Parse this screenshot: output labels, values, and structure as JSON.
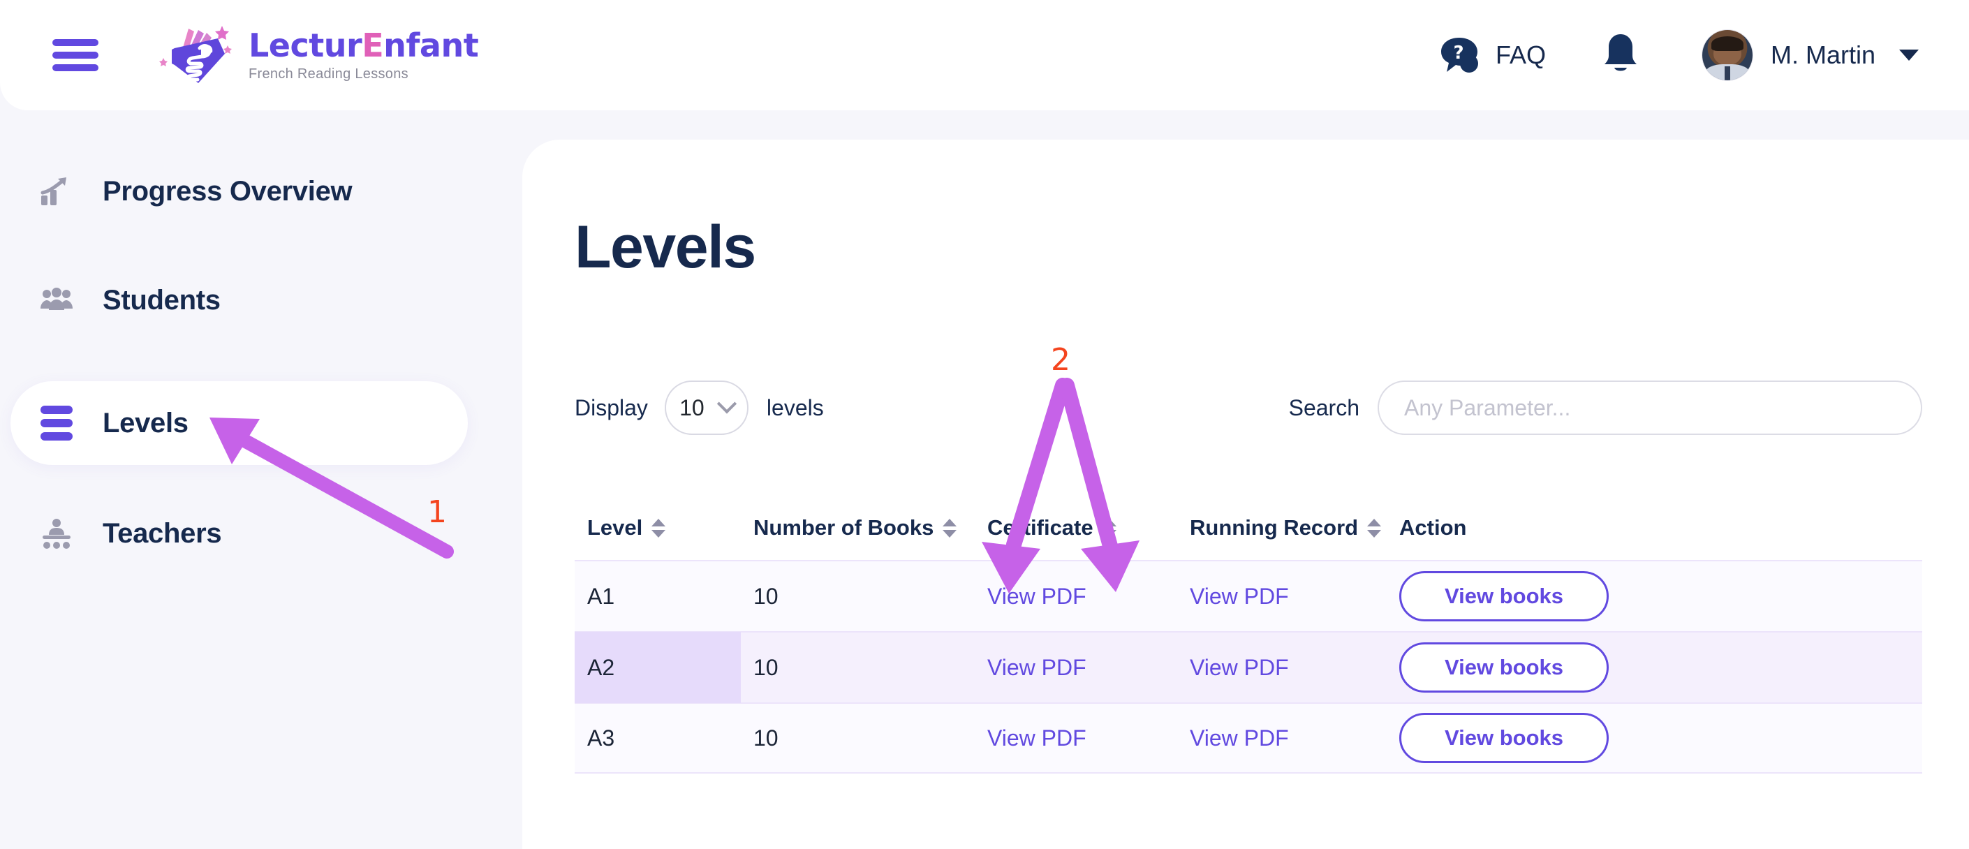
{
  "header": {
    "menu_icon": "hamburger-icon",
    "logo": {
      "title_part1": "Lectur",
      "title_accent": "E",
      "title_part2": "nfant",
      "tagline": "French Reading Lessons"
    },
    "faq_label": "FAQ",
    "faq_icon": "question-chat-icon",
    "notification_icon": "bell-icon",
    "username": "M. Martin",
    "user_caret_icon": "caret-down-icon"
  },
  "sidebar": {
    "items": [
      {
        "label": "Progress Overview",
        "icon": "chart-growth-icon",
        "active": false
      },
      {
        "label": "Students",
        "icon": "group-people-icon",
        "active": false
      },
      {
        "label": "Levels",
        "icon": "bars-list-icon",
        "active": true
      },
      {
        "label": "Teachers",
        "icon": "teacher-icon",
        "active": false
      }
    ]
  },
  "main": {
    "page_title": "Levels",
    "display_label": "Display",
    "display_value": "10",
    "display_suffix": "levels",
    "display_caret_icon": "chevron-down-icon",
    "search_label": "Search",
    "search_placeholder": "Any Parameter...",
    "search_value": ""
  },
  "table": {
    "columns": [
      {
        "label": "Level",
        "sortable": true
      },
      {
        "label": "Number of Books",
        "sortable": true
      },
      {
        "label": "Certificate",
        "sortable": true
      },
      {
        "label": "Running Record",
        "sortable": true
      },
      {
        "label": "Action",
        "sortable": false
      }
    ],
    "rows": [
      {
        "level": "A1",
        "books": "10",
        "certificate": "View PDF",
        "running_record": "View PDF",
        "action": "View books",
        "highlighted": false
      },
      {
        "level": "A2",
        "books": "10",
        "certificate": "View PDF",
        "running_record": "View PDF",
        "action": "View books",
        "highlighted": true
      },
      {
        "level": "A3",
        "books": "10",
        "certificate": "View PDF",
        "running_record": "View PDF",
        "action": "View books",
        "highlighted": false
      }
    ]
  },
  "annotations": [
    {
      "number": "1",
      "target": "sidebar-item-levels"
    },
    {
      "number": "2",
      "target": "certificate-and-running-record-columns"
    }
  ],
  "colors": {
    "accent_purple": "#6149e0",
    "logo_pink": "#e060b8",
    "text_navy": "#16294d",
    "row_highlight": "#f5f0fd",
    "row_highlight_strong": "#e6dbfb",
    "annotation_arrow": "#c662e8",
    "annotation_number": "#f4441e"
  }
}
